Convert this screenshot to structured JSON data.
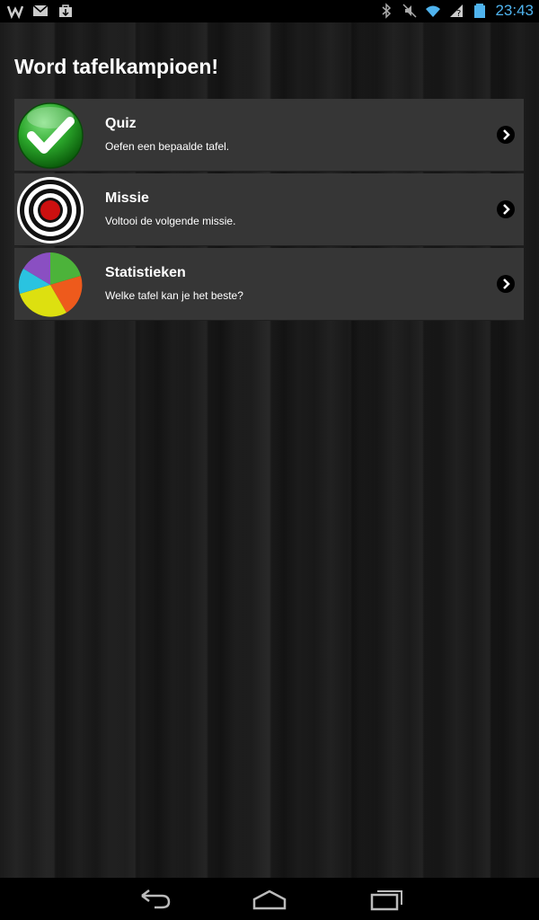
{
  "status_bar": {
    "time": "23:43",
    "left_icons": [
      "w-app-icon",
      "gmail-icon",
      "shopping-bag-icon"
    ],
    "right_icons": [
      "bluetooth-icon",
      "mute-icon",
      "wifi-icon",
      "no-signal-icon",
      "battery-icon"
    ]
  },
  "page": {
    "title": "Word tafelkampioen!"
  },
  "menu": [
    {
      "title": "Quiz",
      "subtitle": "Oefen een bepaalde tafel.",
      "icon": "green-checkmark-icon"
    },
    {
      "title": "Missie",
      "subtitle": "Voltooi de volgende missie.",
      "icon": "target-icon"
    },
    {
      "title": "Statistieken",
      "subtitle": "Welke tafel kan je het beste?",
      "icon": "pie-chart-icon"
    }
  ],
  "colors": {
    "accent_time": "#4fb3ee",
    "item_bg": "#363636",
    "check_green": "#2aa52a",
    "target_red": "#cc1010"
  },
  "nav_bar": {
    "icons": [
      "back-icon",
      "home-icon",
      "recent-apps-icon"
    ]
  }
}
